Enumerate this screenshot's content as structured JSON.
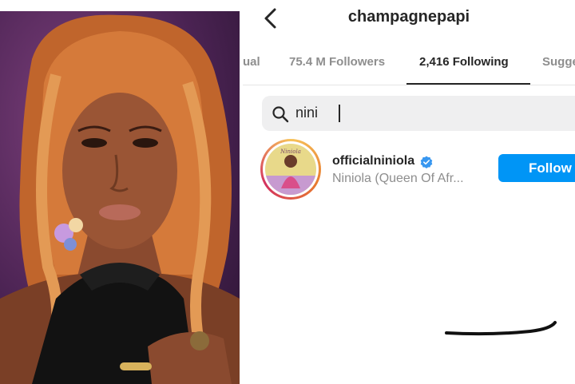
{
  "header": {
    "username": "champagnepapi",
    "back_icon": "chevron-left-icon"
  },
  "tabs": [
    {
      "label": "ual",
      "active": false
    },
    {
      "label": "75.4 M Followers",
      "active": false
    },
    {
      "label": "2,416 Following",
      "active": true
    },
    {
      "label": "Sugge",
      "active": false
    }
  ],
  "search": {
    "icon": "search-icon",
    "query": "nini"
  },
  "results": [
    {
      "username": "officialniniola",
      "verified": true,
      "full_name": "Niniola (Queen Of Afr...",
      "follow_label": "Follow",
      "avatar_caption": "Niniola"
    }
  ],
  "colors": {
    "accent": "#0095f6",
    "text_primary": "#262626",
    "text_secondary": "#8e8e8e",
    "search_bg": "#efeff0"
  }
}
